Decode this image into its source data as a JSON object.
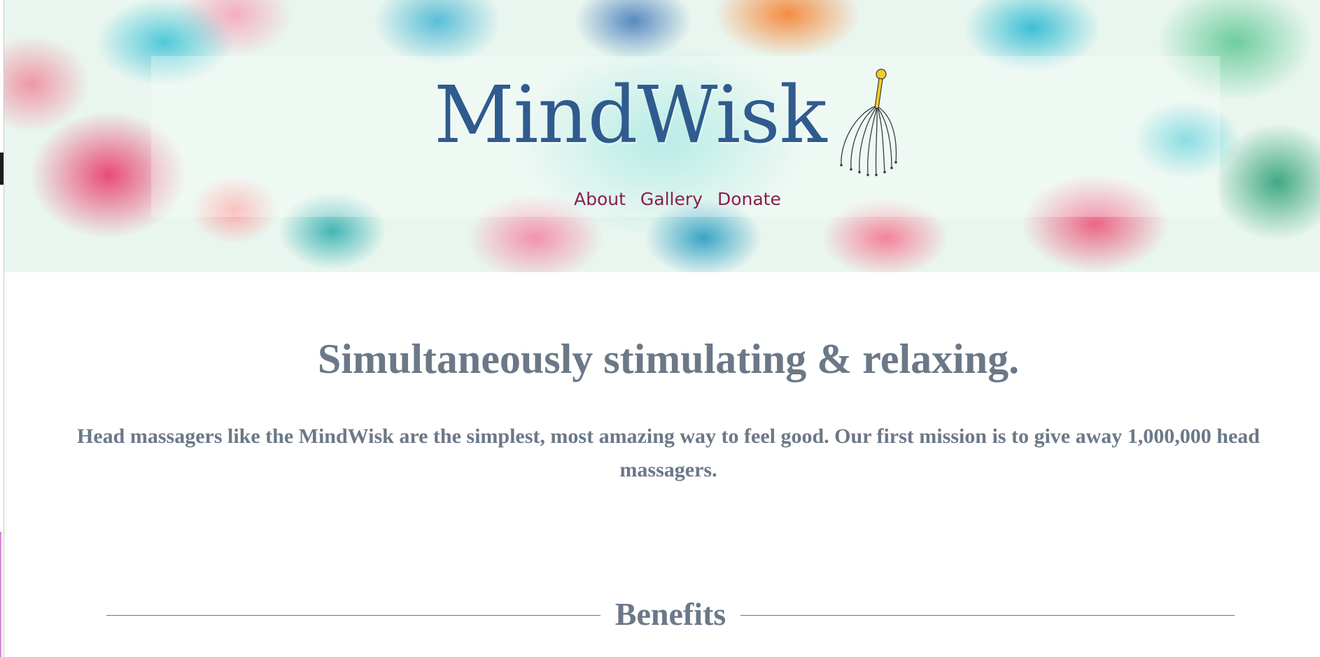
{
  "header": {
    "site_title": "MindWisk",
    "logo_icon": "head-massager-whisk-icon",
    "nav": [
      {
        "label": "About"
      },
      {
        "label": "Gallery"
      },
      {
        "label": "Donate"
      }
    ]
  },
  "hero": {
    "headline": "Simultaneously stimulating & relaxing.",
    "mission": "Head massagers like the MindWisk are the simplest, most amazing way to feel good. Our first mission is to give away 1,000,000 head massagers."
  },
  "benefits": {
    "heading": "Benefits"
  },
  "colors": {
    "title": "#2f5b8e",
    "nav_link": "#8a1f4a",
    "body_text": "#6b7888",
    "whisk_handle": "#f2cd2a"
  }
}
